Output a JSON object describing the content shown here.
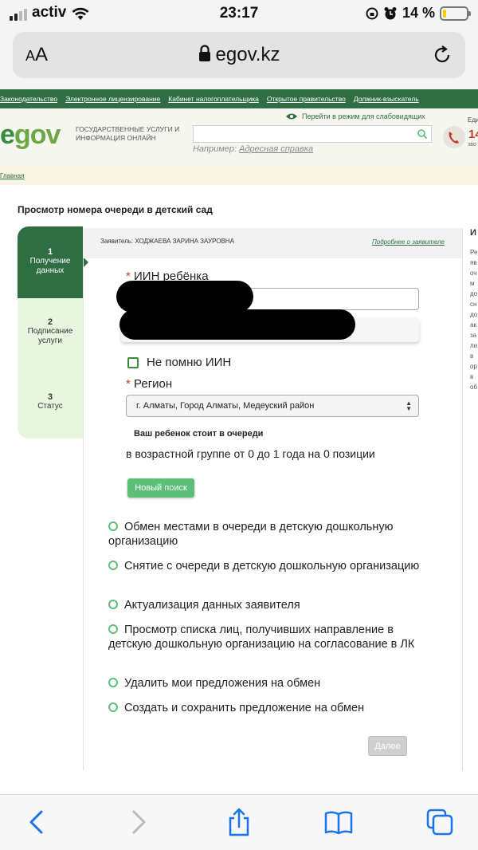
{
  "status_bar": {
    "carrier": "activ",
    "time": "23:17",
    "battery": "14 %",
    "battery_level": 0.14,
    "battery_color": "#f4d000"
  },
  "browser": {
    "text_size_label": "AA",
    "url": "egov.kz",
    "icons": [
      "lock-icon",
      "reload-icon",
      "back-icon",
      "forward-icon",
      "share-icon",
      "bookmarks-icon",
      "tabs-icon"
    ]
  },
  "site": {
    "top_nav": [
      "Законодательство",
      "Электронное лицензирование",
      "Кабинет налогоплательщика",
      "Открытое правительство",
      "Должник-взыскатель"
    ],
    "logo": {
      "part1": "e",
      "part2": "gov"
    },
    "tagline": "ГОСУДАРСТВЕННЫЕ УСЛУГИ И ИНФОРМАЦИЯ ОНЛАЙН",
    "vision_mode": "Перейти в режим для слабовидящих",
    "search_example_label": "Например:",
    "search_example_link": "Адресная справка",
    "hotline_a": "Еди",
    "hotline_b": "14",
    "hotline_c": "зво",
    "breadcrumb": "Главная",
    "brand_color": "#2f6e43",
    "accent_color": "#5bbf7a"
  },
  "page": {
    "title": "Просмотр номера очереди в детский сад",
    "steps": [
      {
        "num": "1",
        "label": "Получение данных"
      },
      {
        "num": "2",
        "label": "Подписание услуги"
      },
      {
        "num": "3",
        "label": "Статус"
      }
    ],
    "applicant": "Заявитель: ХОДЖАЕВА ЗАРИНА ЗАУРОВНА",
    "applicant_more": "Подробнее о заявителе",
    "side_info_title": "И",
    "side_info_text": "Ре яв оч м до сн до ак за ли в ор в об",
    "iin_label": "ИИН ребёнка",
    "forgot_iin": "Не помню ИИН",
    "region_label": "Регион",
    "region_value": "г. Алматы, Город Алматы, Медеуский район",
    "queue_head": "Ваш ребенок стоит в очереди",
    "queue_text": "в возрастной группе от 0 до 1 года на 0 позиции",
    "new_search": "Новый поиск",
    "options": [
      "Обмен местами в очереди в детскую дошкольную организацию",
      "Снятие с очереди в детскую дошкольную организацию",
      "Актуализация данных заявителя",
      "Просмотр списка лиц, получивших направление в детскую дошкольную организацию на согласование в ЛК",
      "Удалить мои предложения на обмен",
      "Создать и сохранить предложение на обмен"
    ],
    "next": "Далее"
  }
}
